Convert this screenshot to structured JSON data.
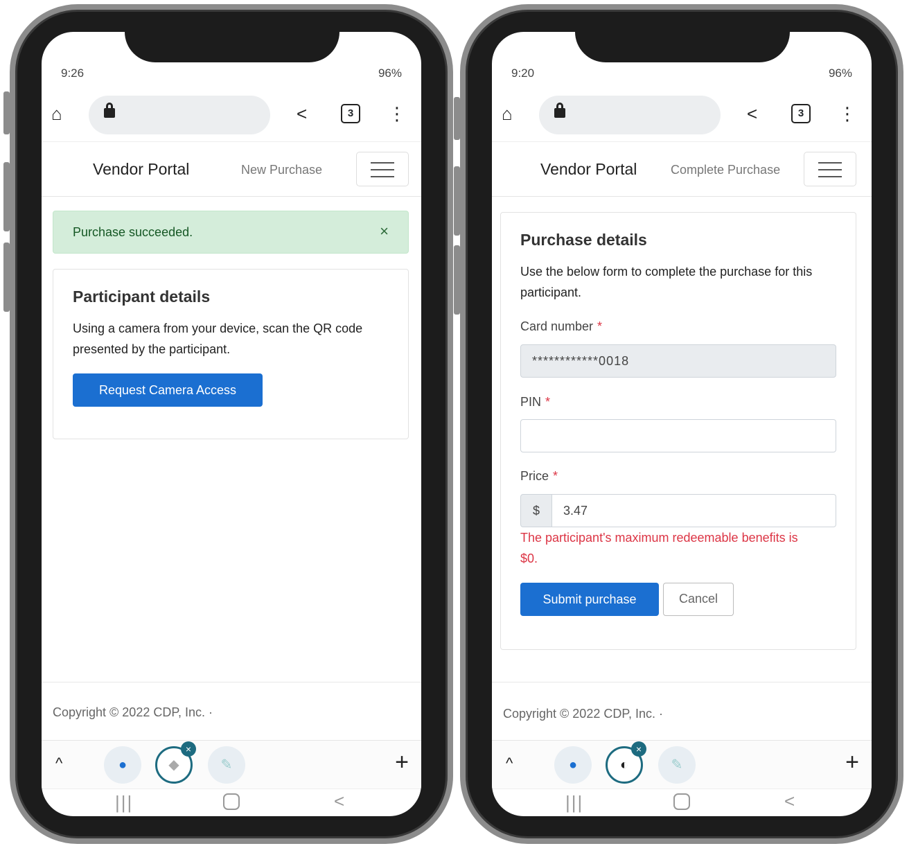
{
  "left": {
    "status": {
      "time": "9:26",
      "right": "96%"
    },
    "browser": {
      "tabs_count": "3"
    },
    "navbar": {
      "brand": "Vendor Portal",
      "link": "New Purchase"
    },
    "alert": {
      "message": "Purchase succeeded.",
      "close": "×"
    },
    "card": {
      "title": "Participant details",
      "text": "Using a camera from your device, scan the QR code presented by the participant.",
      "button": "Request Camera Access"
    },
    "footer": "Copyright © 2022 CDP, Inc. ·"
  },
  "right": {
    "status": {
      "time": "9:20",
      "right": "96%"
    },
    "browser": {
      "tabs_count": "3"
    },
    "navbar": {
      "brand": "Vendor Portal",
      "link": "Complete Purchase"
    },
    "card": {
      "title": "Purchase details",
      "text": "Use the below form to complete the purchase for this participant.",
      "card_number_label": "Card number",
      "card_number_value": "************0018",
      "pin_label": "PIN",
      "pin_value": "",
      "price_label": "Price",
      "price_prefix": "$",
      "price_value": "3.47",
      "required_mark": "*",
      "error": "The participant's maximum redeemable benefits is $0.",
      "submit": "Submit purchase",
      "cancel": "Cancel"
    },
    "footer": "Copyright © 2022 CDP, Inc. ·"
  },
  "icons": {
    "home": "⌂",
    "share": "<",
    "menu": "⋮",
    "chevron": "^",
    "plus": "+",
    "recent": "|||",
    "back": "<",
    "close": "×"
  },
  "colors": {
    "primary": "#1b6fd1",
    "success_bg": "#d4edda",
    "danger": "#dc3545"
  }
}
